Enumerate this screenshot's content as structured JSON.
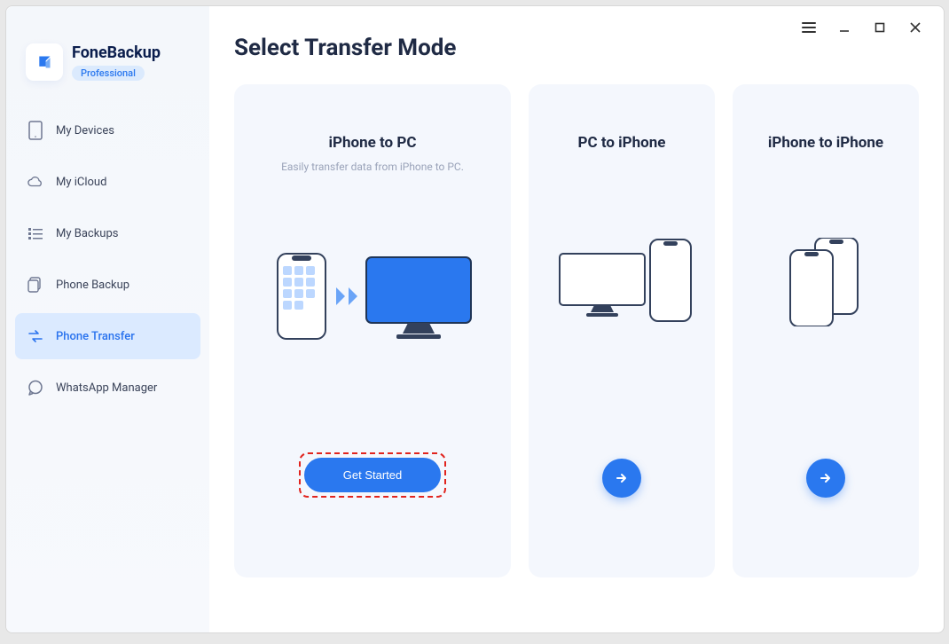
{
  "brand": {
    "title": "FoneBackup",
    "badge": "Professional"
  },
  "sidebar": {
    "items": [
      {
        "id": "my-devices",
        "label": "My Devices",
        "active": false
      },
      {
        "id": "my-icloud",
        "label": "My iCloud",
        "active": false
      },
      {
        "id": "my-backups",
        "label": "My Backups",
        "active": false
      },
      {
        "id": "phone-backup",
        "label": "Phone Backup",
        "active": false
      },
      {
        "id": "phone-transfer",
        "label": "Phone Transfer",
        "active": true
      },
      {
        "id": "whatsapp-mgr",
        "label": "WhatsApp Manager",
        "active": false
      }
    ]
  },
  "main": {
    "title": "Select Transfer Mode",
    "cards": [
      {
        "title": "iPhone to PC",
        "subtitle": "Easily transfer data from iPhone to PC.",
        "cta": "Get Started"
      },
      {
        "title": "PC to iPhone",
        "subtitle": ""
      },
      {
        "title": "iPhone to iPhone",
        "subtitle": ""
      }
    ]
  }
}
